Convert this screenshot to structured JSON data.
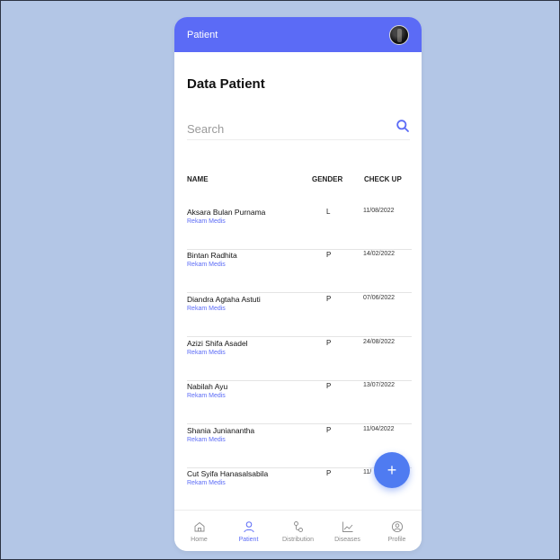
{
  "appbar": {
    "title": "Patient"
  },
  "page": {
    "title": "Data Patient"
  },
  "search": {
    "placeholder": "Search"
  },
  "table": {
    "headers": {
      "name": "NAME",
      "gender": "GENDER",
      "checkup": "CHECK UP"
    },
    "rows": [
      {
        "name": "Aksara Bulan Purnama",
        "link": "Rekam Medis",
        "gender": "L",
        "checkup": "11/08/2022"
      },
      {
        "name": "Bintan Radhita",
        "link": "Rekam Medis",
        "gender": "P",
        "checkup": "14/02/2022"
      },
      {
        "name": "Diandra Agtaha Astuti",
        "link": "Rekam Medis",
        "gender": "P",
        "checkup": "07/06/2022"
      },
      {
        "name": "Azizi Shifa Asadel",
        "link": "Rekam Medis",
        "gender": "P",
        "checkup": "24/08/2022"
      },
      {
        "name": "Nabilah Ayu",
        "link": "Rekam Medis",
        "gender": "P",
        "checkup": "13/07/2022"
      },
      {
        "name": "Shania Junianantha",
        "link": "Rekam Medis",
        "gender": "P",
        "checkup": "11/04/2022"
      },
      {
        "name": "Cut Syifa Hanasalsabila",
        "link": "Rekam Medis",
        "gender": "P",
        "checkup": "11/"
      }
    ]
  },
  "fab": {
    "label": "+"
  },
  "nav": {
    "items": [
      {
        "label": "Home",
        "icon": "home-icon",
        "active": false
      },
      {
        "label": "Patient",
        "icon": "user-icon",
        "active": true
      },
      {
        "label": "Distribution",
        "icon": "distribution-icon",
        "active": false
      },
      {
        "label": "Diseases",
        "icon": "chart-icon",
        "active": false
      },
      {
        "label": "Profile",
        "icon": "profile-icon",
        "active": false
      }
    ]
  },
  "colors": {
    "accent": "#5b6bf6",
    "fab": "#4f7bf1",
    "background": "#b3c6e6"
  }
}
